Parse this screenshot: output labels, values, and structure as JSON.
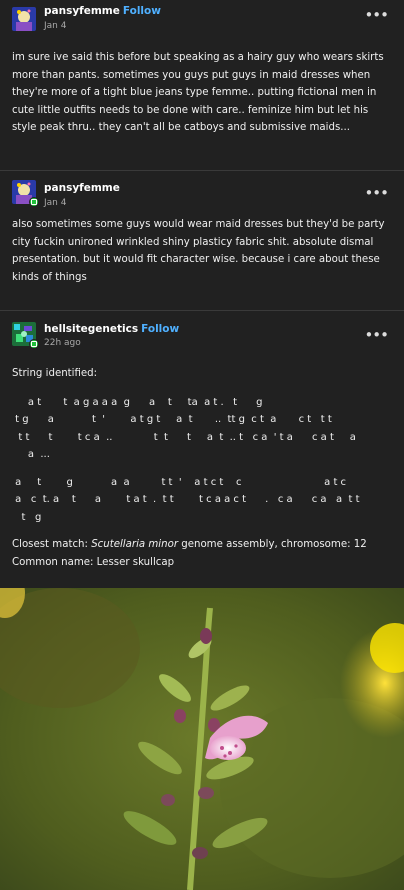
{
  "posts": [
    {
      "username": "pansyfemme",
      "follow_label": "Follow",
      "date": "Jan 4",
      "text": "im sure ive said this before but speaking as a hairy guy who wears skirts more than pants. sometimes you guys put guys in maid dresses when they're more of a tight blue jeans type femme.. putting fictional men in cute little outfits needs to be done with care.. feminize him but let his style peak thru.. they can't all be catboys and submissive maids..."
    },
    {
      "username": "pansyfemme",
      "date": "Jan 4",
      "text": "also sometimes some guys would wear maid dresses but they'd be party city fuckin unironed wrinkled shiny plasticy fabric shit. absolute dismal presentation. but it would fit character wise. because i care about these kinds of things"
    },
    {
      "username": "hellsitegenetics",
      "follow_label": "Follow",
      "date": "22h ago",
      "intro": "String identified:",
      "dna_block_1": [
        "     a t       t  a g a a a  g      a    t     ta  a t .   t      g",
        " t g      a            t  '        a t g t     a  t       ..  tt g  c t  a       c t   t t",
        "  t t      t        t c a  ..             t  t      t     a  t  .. t   c a  ' t a      c a t     a",
        "     a  ..."
      ],
      "dna_block_2": [
        " a     t        g            a  a          t t  '    a t c t    c                          a t c",
        " a   c  t. a    t      a        t a t  .  t t        t c a a c t      .   c a      c a   a  t t",
        "   t   g"
      ],
      "match_prefix": "Closest match: ",
      "match_species": "Scutellaria minor",
      "match_suffix": " genome assembly, chromosome: 12",
      "common_name": "Common name: Lesser skullcap"
    }
  ],
  "icons": {
    "more": "more-horizontal-icon",
    "badge": "reblog-badge-icon"
  },
  "colors": {
    "background": "#212121",
    "follow": "#4fb0ff",
    "badge": "#1fbf3a"
  }
}
